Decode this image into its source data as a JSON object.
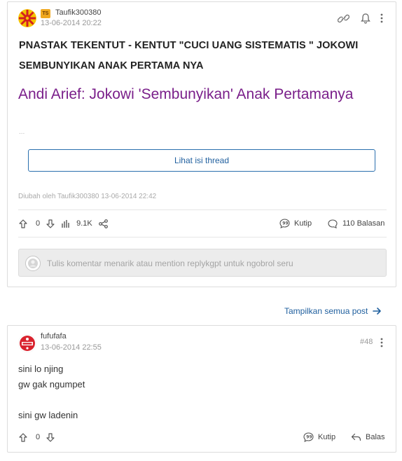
{
  "thread": {
    "author": {
      "username": "Taufik300380",
      "badge": "TS",
      "timestamp": "13-06-2014 20:22"
    },
    "title_line1": "PNASTAK TEKENTUT - KENTUT \"CUCI UANG SISTEMATIS \" JOKOWI",
    "title_line2": "SEMBUNYIKAN ANAK PERTAMA NYA",
    "article_link": "Andi Arief: Jokowi 'Sembunyikan' Anak Pertamanya",
    "truncation": "...",
    "view_button": "Lihat isi thread",
    "edited_note": "Diubah oleh Taufik300380 13-06-2014 22:42",
    "upvotes": "0",
    "views": "9.1K",
    "quote_label": "Kutip",
    "replies_label": "110 Balasan",
    "comment_placeholder": "Tulis komentar menarik atau mention replykgpt untuk ngobrol seru"
  },
  "show_all_posts": "Tampilkan semua post",
  "reply": {
    "author": {
      "username": "fufufafa",
      "timestamp": "13-06-2014 22:55"
    },
    "post_number": "#48",
    "body": [
      "sini lo njing",
      "gw gak ngumpet",
      "",
      "sini gw ladenin"
    ],
    "upvotes": "0",
    "quote_label": "Kutip",
    "reply_label": "Balas"
  },
  "colors": {
    "accent_blue": "#1f5f9e",
    "link_purple": "#7a1f8a",
    "badge_orange": "#f0a81e",
    "reply_avatar_red": "#d9232e"
  }
}
